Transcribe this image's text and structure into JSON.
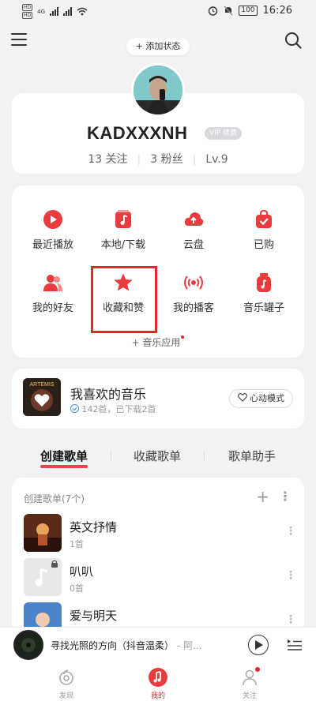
{
  "status_bar": {
    "left_badges": [
      "HD",
      "HD"
    ],
    "network": "4G",
    "battery": "100",
    "time": "16:26"
  },
  "header": {
    "add_status_label": "+ 添加状态"
  },
  "profile": {
    "username": "KADXXXNH",
    "vip_label": "VIP 续费",
    "following": "13 关注",
    "followers": "3 粉丝",
    "level": "Lv.9"
  },
  "features": [
    {
      "label": "最近播放",
      "icon": "play-icon"
    },
    {
      "label": "本地/下载",
      "icon": "music-note-icon"
    },
    {
      "label": "云盘",
      "icon": "cloud-upload-icon"
    },
    {
      "label": "已购",
      "icon": "bag-check-icon"
    },
    {
      "label": "我的好友",
      "icon": "friends-icon"
    },
    {
      "label": "收藏和赞",
      "icon": "star-icon"
    },
    {
      "label": "我的播客",
      "icon": "broadcast-icon"
    },
    {
      "label": "音乐罐子",
      "icon": "music-jar-icon"
    }
  ],
  "music_app_label": "+ 音乐应用",
  "liked": {
    "title": "我喜欢的音乐",
    "cover_text": "ARTEMIS",
    "subtitle": "142首，已下载2首",
    "mode_button": "心动模式"
  },
  "tabs": [
    {
      "label": "创建歌单",
      "active": true
    },
    {
      "label": "收藏歌单",
      "active": false
    },
    {
      "label": "歌单助手",
      "active": false
    }
  ],
  "playlists": {
    "header": "创建歌单(7个)",
    "items": [
      {
        "name": "英文抒情",
        "count": "1首"
      },
      {
        "name": "叭叭",
        "count": "0首"
      },
      {
        "name": "爱与明天",
        "count": ""
      }
    ]
  },
  "player": {
    "title": "寻找光照的方向（抖音温柔）",
    "artist": " - 阿..."
  },
  "bottom_nav": [
    {
      "label": "发现"
    },
    {
      "label": "我的"
    },
    {
      "label": "关注"
    }
  ],
  "colors": {
    "accent": "#e8262c",
    "background": "#f2f2f4"
  }
}
